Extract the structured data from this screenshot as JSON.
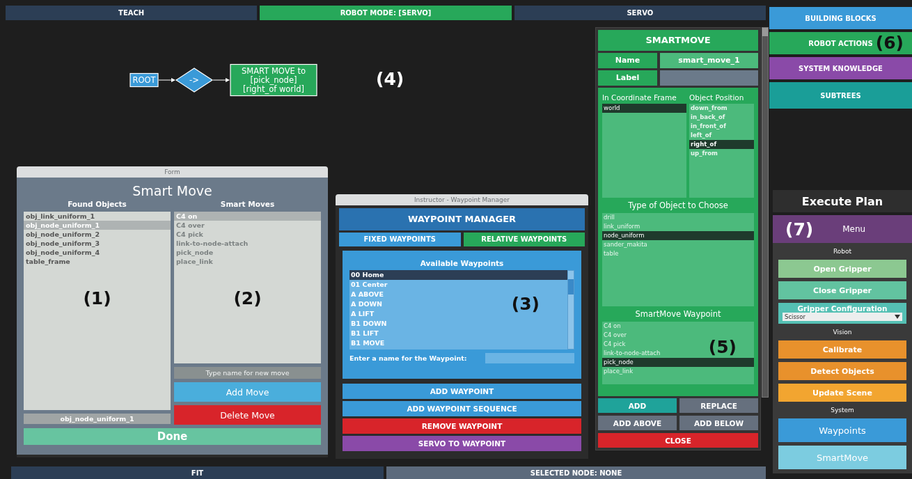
{
  "top_bar": [
    {
      "label": "TEACH",
      "selected": false
    },
    {
      "label": "ROBOT MODE: [SERVO]",
      "selected": true
    },
    {
      "label": "SERVO",
      "selected": false
    }
  ],
  "canvas": {
    "callout": "(4)",
    "nodes": [
      {
        "kind": "rect",
        "lines": [
          "ROOT"
        ]
      },
      {
        "kind": "diamond",
        "lines": [
          "->"
        ]
      },
      {
        "kind": "rect",
        "lines": [
          "SMART MOVE to",
          "[pick_node]",
          "[right_of world]"
        ]
      }
    ]
  },
  "form_window": {
    "title": "Form",
    "heading": "Smart Move",
    "found_objects": {
      "title": "Found Objects",
      "callout": "(1)",
      "items": [
        {
          "label": "obj_link_uniform_1",
          "selected": false
        },
        {
          "label": "obj_node_uniform_1",
          "selected": true
        },
        {
          "label": "obj_node_uniform_2",
          "selected": false
        },
        {
          "label": "obj_node_uniform_3",
          "selected": false
        },
        {
          "label": "obj_node_uniform_4",
          "selected": false
        },
        {
          "label": "table_frame",
          "selected": false
        }
      ]
    },
    "smart_moves": {
      "title": "Smart Moves",
      "callout": "(2)",
      "items": [
        {
          "label": "C4 on",
          "selected": true
        },
        {
          "label": "C4 over",
          "selected": false
        },
        {
          "label": "C4 pick",
          "selected": false
        },
        {
          "label": "link-to-node-attach",
          "selected": false
        },
        {
          "label": "pick_node",
          "selected": false
        },
        {
          "label": "place_link",
          "selected": false
        }
      ]
    },
    "selected_object": "obj_node_uniform_1",
    "new_move": {
      "placeholder": "Type name for new move"
    },
    "add_button": "Add Move",
    "delete_button": "Delete Move",
    "done_button": "Done"
  },
  "waypoint_window": {
    "title": "Instructor - Waypoint Manager",
    "heading": "WAYPOINT MANAGER",
    "tabs": [
      {
        "label": "FIXED WAYPOINTS",
        "selected": false
      },
      {
        "label": "RELATIVE WAYPOINTS",
        "selected": true
      }
    ],
    "list_title": "Available Waypoints",
    "callout": "(3)",
    "waypoints": [
      {
        "label": "00 Home",
        "selected": true
      },
      {
        "label": "01 Center",
        "selected": false
      },
      {
        "label": "A ABOVE",
        "selected": false
      },
      {
        "label": "A DOWN",
        "selected": false
      },
      {
        "label": "A LIFT",
        "selected": false
      },
      {
        "label": "B1 DOWN",
        "selected": false
      },
      {
        "label": "B1 LIFT",
        "selected": false
      },
      {
        "label": "B1 MOVE",
        "selected": false
      }
    ],
    "name_label": "Enter a name for the Waypoint:",
    "buttons": [
      {
        "label": "ADD WAYPOINT",
        "color": "#3a9ad8"
      },
      {
        "label": "ADD WAYPOINT SEQUENCE",
        "color": "#3a9ad8"
      },
      {
        "label": "REMOVE WAYPOINT",
        "color": "#d8242a"
      },
      {
        "label": "SERVO TO WAYPOINT",
        "color": "#8a4aa8"
      }
    ]
  },
  "smartmove_panel": {
    "heading": "SMARTMOVE",
    "name_label": "Name",
    "name_value": "smart_move_1",
    "label_label": "Label",
    "coordinate_frame": {
      "title": "In Coordinate Frame",
      "items": [
        {
          "label": "world",
          "selected": true
        }
      ]
    },
    "object_position": {
      "title": "Object Position",
      "items": [
        {
          "label": "down_from",
          "selected": false
        },
        {
          "label": "in_back_of",
          "selected": false
        },
        {
          "label": "in_front_of",
          "selected": false
        },
        {
          "label": "left_of",
          "selected": false
        },
        {
          "label": "right_of",
          "selected": true
        },
        {
          "label": "up_from",
          "selected": false
        }
      ]
    },
    "object_type": {
      "title": "Type of Object to Choose",
      "items": [
        {
          "label": "drill",
          "selected": false
        },
        {
          "label": "link_uniform",
          "selected": false
        },
        {
          "label": "node_uniform",
          "selected": true
        },
        {
          "label": "sander_makita",
          "selected": false
        },
        {
          "label": "table",
          "selected": false
        }
      ]
    },
    "waypoint": {
      "title": "SmartMove Waypoint",
      "callout": "(5)",
      "items": [
        {
          "label": "C4 on",
          "selected": false
        },
        {
          "label": "C4 over",
          "selected": false
        },
        {
          "label": "C4 pick",
          "selected": false
        },
        {
          "label": "link-to-node-attach",
          "selected": false
        },
        {
          "label": "pick_node",
          "selected": true
        },
        {
          "label": "place_link",
          "selected": false
        }
      ]
    },
    "buttons": [
      {
        "label": "ADD",
        "color": "#1fa39a"
      },
      {
        "label": "REPLACE",
        "color": "#66707e"
      },
      {
        "label": "ADD ABOVE",
        "color": "#66707e"
      },
      {
        "label": "ADD BELOW",
        "color": "#66707e"
      },
      {
        "label": "CLOSE",
        "color": "#d8242a"
      }
    ]
  },
  "categories": {
    "items": [
      {
        "label": "BUILDING BLOCKS",
        "color": "#3a9ad8"
      },
      {
        "label": "ROBOT ACTIONS",
        "color": "#27a85a",
        "callout": "(6)"
      },
      {
        "label": "SYSTEM KNOWLEDGE",
        "color": "#8a4aa8"
      },
      {
        "label": "SUBTREES",
        "color": "#1a9e98"
      }
    ]
  },
  "execute_plan": "Execute Plan",
  "menu": {
    "title": "Menu",
    "callout": "(7)",
    "items": [
      {
        "kind": "heading",
        "label": "Robot"
      },
      {
        "kind": "button",
        "label": "Open Gripper",
        "color": "#8cc891"
      },
      {
        "kind": "button",
        "label": "Close Gripper",
        "color": "#62c3a0"
      },
      {
        "kind": "dropdown",
        "label": "Gripper Configuration",
        "value": "Scissor",
        "color": "#55c0b4"
      },
      {
        "kind": "heading",
        "label": "Vision"
      },
      {
        "kind": "button",
        "label": "Calibrate",
        "color": "#e8912c"
      },
      {
        "kind": "button",
        "label": "Detect Objects",
        "color": "#e8912c"
      },
      {
        "kind": "button",
        "label": "Update Scene",
        "color": "#f2a530"
      },
      {
        "kind": "heading",
        "label": "System"
      },
      {
        "kind": "big-button",
        "label": "Waypoints",
        "color": "#3a9ad8"
      },
      {
        "kind": "big-button",
        "label": "SmartMove",
        "color": "#7ccce0"
      }
    ]
  },
  "bottom_bar": [
    {
      "label": "FIT",
      "color": "#2c3e55"
    },
    {
      "label": "SELECTED NODE: NONE",
      "color": "#5c6a7c"
    }
  ]
}
